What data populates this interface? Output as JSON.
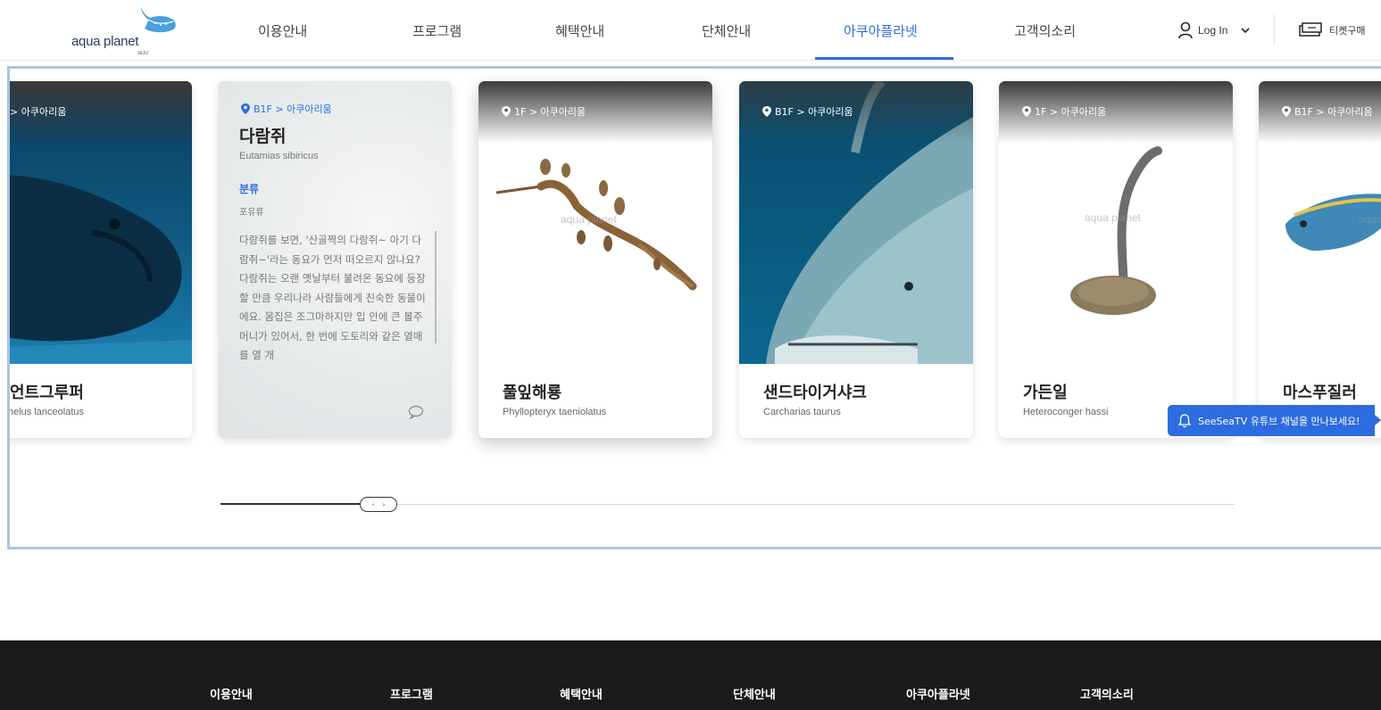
{
  "header": {
    "logo_text": "aqua planet",
    "logo_sub": "JEJU",
    "nav": [
      "이용안내",
      "프로그램",
      "혜택안내",
      "단체안내",
      "아쿠아플라넷",
      "고객의소리"
    ],
    "active_nav": "아쿠아플라넷",
    "login_label": "Log In",
    "ticket_label": "티켓구매"
  },
  "cards": [
    {
      "location": "> 아쿠아리움",
      "name": "언트그루퍼",
      "scientific": "helus lanceolatus"
    },
    {
      "location": "B1F > 아쿠아리움",
      "name": "다람쥐",
      "scientific": "Eutamias sibiricus",
      "category_label": "분류",
      "category": "포유류",
      "description": "다람쥐를 보면, '산골짝의 다람쥐~ 아기 다람쥐~'라는 동요가 먼저 떠오르지 않나요? 다람쥐는 오랜 옛날부터 불려온 동요에 등장할 만큼 우리나라 사람들에게 친숙한 동물이에요. 몸집은 조그마하지만 입 안에 큰 볼주머니가 있어서, 한 번에 도토리와 같은 열매를 열 개"
    },
    {
      "location": "1F > 아쿠아리움",
      "name": "풀잎해룡",
      "scientific": "Phyllopteryx taeniolatus",
      "watermark": "aqua planet"
    },
    {
      "location": "B1F > 아쿠아리움",
      "name": "샌드타이거샤크",
      "scientific": "Carcharias taurus"
    },
    {
      "location": "1F > 아쿠아리움",
      "name": "가든일",
      "scientific": "Heteroconger hassi",
      "watermark": "aqua planet"
    },
    {
      "location": "B1F > 아쿠아리움",
      "name": "마스푸질러",
      "scientific": "",
      "watermark": "aqua p"
    }
  ],
  "slider": {
    "progress_percent": 14
  },
  "notification": {
    "text": "SeeSeaTV 유튜브 채널을 만나보세요!"
  },
  "footer": {
    "nav": [
      "이용안내",
      "프로그램",
      "혜택안내",
      "단체안내",
      "아쿠아플라넷",
      "고객의소리"
    ]
  },
  "colors": {
    "accent": "#2d6cdf",
    "frame": "#a7c6e3",
    "footer": "#1b1b1b"
  },
  "icons": [
    "whale-shark-logo-icon",
    "user-icon",
    "chevron-down-icon",
    "ticket-icon",
    "location-pin-icon",
    "rotate-icon",
    "bell-icon"
  ]
}
